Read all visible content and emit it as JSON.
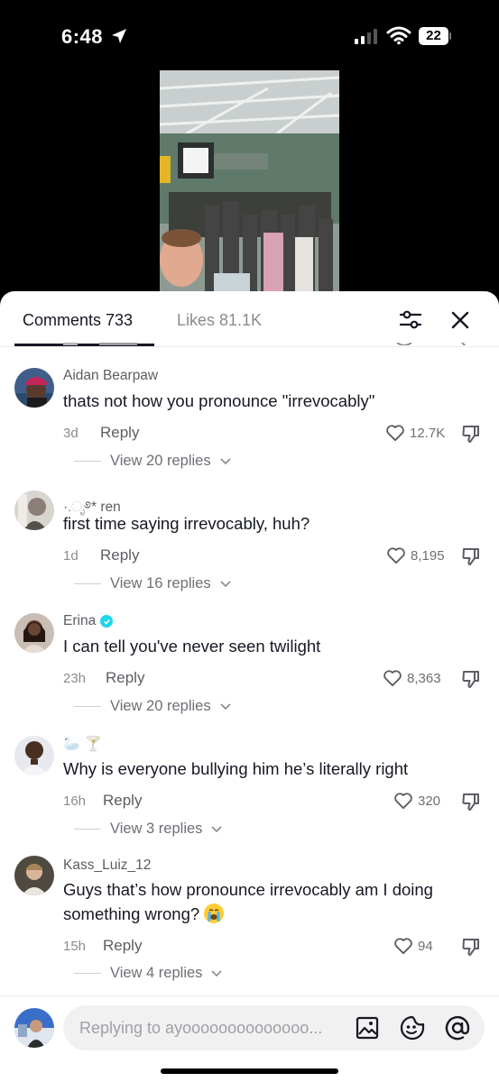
{
  "status_bar": {
    "time": "6:48",
    "battery": "22"
  },
  "tabs": {
    "comments": "Comments 733",
    "likes": "Likes 81.1K"
  },
  "reply_label": "Reply",
  "comments": [
    {
      "username": "Aidan Bearpaw",
      "text": "thats not how you pronounce \"irrevocably\"",
      "age": "3d",
      "likes": "12.7K",
      "view_replies": "View 20 replies"
    },
    {
      "username": "·.ೃ࿔* ren",
      "text": "first time saying irrevocably, huh?",
      "age": "1d",
      "likes": "8,195",
      "view_replies": "View 16 replies"
    },
    {
      "username": "Erina",
      "verified": true,
      "text": "I can tell you've never seen twilight",
      "age": "23h",
      "likes": "8,363",
      "view_replies": "View 20 replies"
    },
    {
      "username": "🦢 🍸",
      "text": "Why is everyone bullying him he’s literally right",
      "age": "16h",
      "likes": "320",
      "view_replies": "View 3 replies"
    },
    {
      "username": "Kass_Luiz_12",
      "text": "Guys that’s how pronounce irrevocably am I doing something wrong?",
      "age": "15h",
      "likes": "94",
      "view_replies": "View 4 replies"
    }
  ],
  "composer": {
    "placeholder": "Replying to ayoooooooooooooo..."
  },
  "icons": [
    "location-arrow-icon",
    "signal-icon",
    "wifi-icon",
    "battery-icon",
    "filter-icon",
    "close-icon",
    "heart-icon",
    "dislike-icon",
    "chevron-down-icon",
    "verified-icon",
    "image-icon",
    "emoji-icon",
    "at-icon"
  ]
}
